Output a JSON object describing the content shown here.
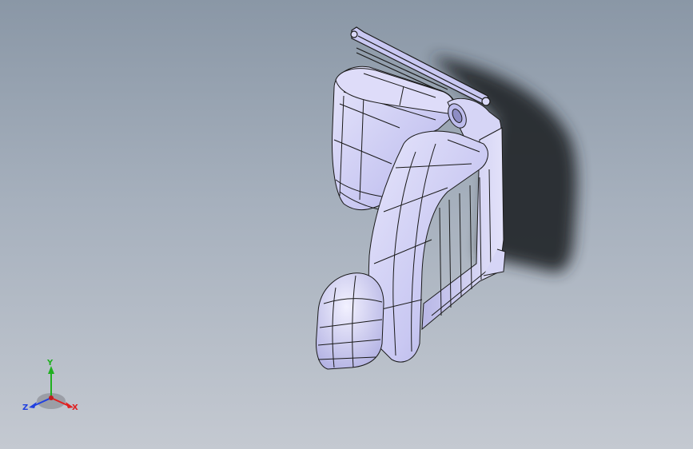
{
  "viewport": {
    "background_top": "#8a97a6",
    "background_bottom": "#c4c9d1"
  },
  "model": {
    "shading": "shaded-with-edges",
    "body_color": "#c9c8f2",
    "edge_color": "#1a1a1a",
    "shadow_color": "#2a2d33"
  },
  "triad": {
    "x_label": "X",
    "y_label": "Y",
    "z_label": "Z",
    "x_color": "#e02020",
    "y_color": "#20b020",
    "z_color": "#2040e0"
  }
}
